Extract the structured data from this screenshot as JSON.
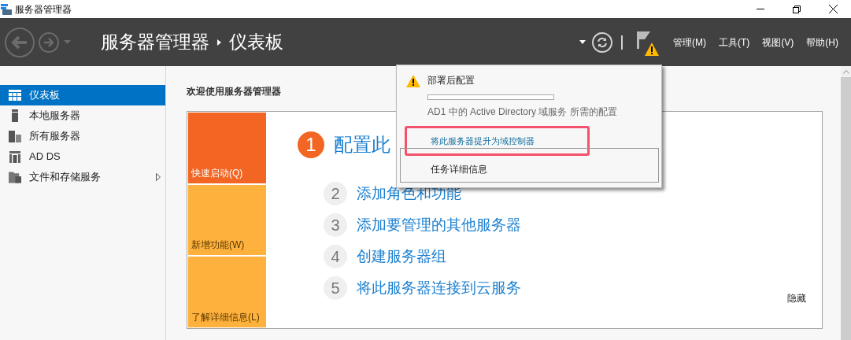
{
  "window": {
    "title": "服务器管理器"
  },
  "header": {
    "breadcrumb": [
      "服务器管理器",
      "仪表板"
    ],
    "menus": [
      "管理(M)",
      "工具(T)",
      "视图(V)",
      "帮助(H)"
    ]
  },
  "sidebar": {
    "items": [
      {
        "label": "仪表板",
        "selected": true,
        "has_submenu": false
      },
      {
        "label": "本地服务器",
        "selected": false,
        "has_submenu": false
      },
      {
        "label": "所有服务器",
        "selected": false,
        "has_submenu": false
      },
      {
        "label": "AD DS",
        "selected": false,
        "has_submenu": false
      },
      {
        "label": "文件和存储服务",
        "selected": false,
        "has_submenu": true
      }
    ]
  },
  "welcome": {
    "heading": "欢迎使用服务器管理器",
    "tiles": [
      {
        "label": "快速启动(Q)",
        "selected": true
      },
      {
        "label": "新增功能(W)",
        "selected": false
      },
      {
        "label": "了解详细信息(L)",
        "selected": false
      }
    ],
    "steps": [
      {
        "number": "1",
        "label": "配置此",
        "selected": true
      },
      {
        "number": "2",
        "label": "添加角色和功能",
        "selected": false
      },
      {
        "number": "3",
        "label": "添加要管理的其他服务器",
        "selected": false
      },
      {
        "number": "4",
        "label": "创建服务器组",
        "selected": false
      },
      {
        "number": "5",
        "label": "将此服务器连接到云服务",
        "selected": false
      }
    ],
    "hide": "隐藏"
  },
  "notification": {
    "title": "部署后配置",
    "level": 0,
    "description": "AD1 中的 Active Directory 域服务 所需的配置",
    "action_link": "将此服务器提升为域控制器",
    "details_button": "任务详细信息"
  }
}
